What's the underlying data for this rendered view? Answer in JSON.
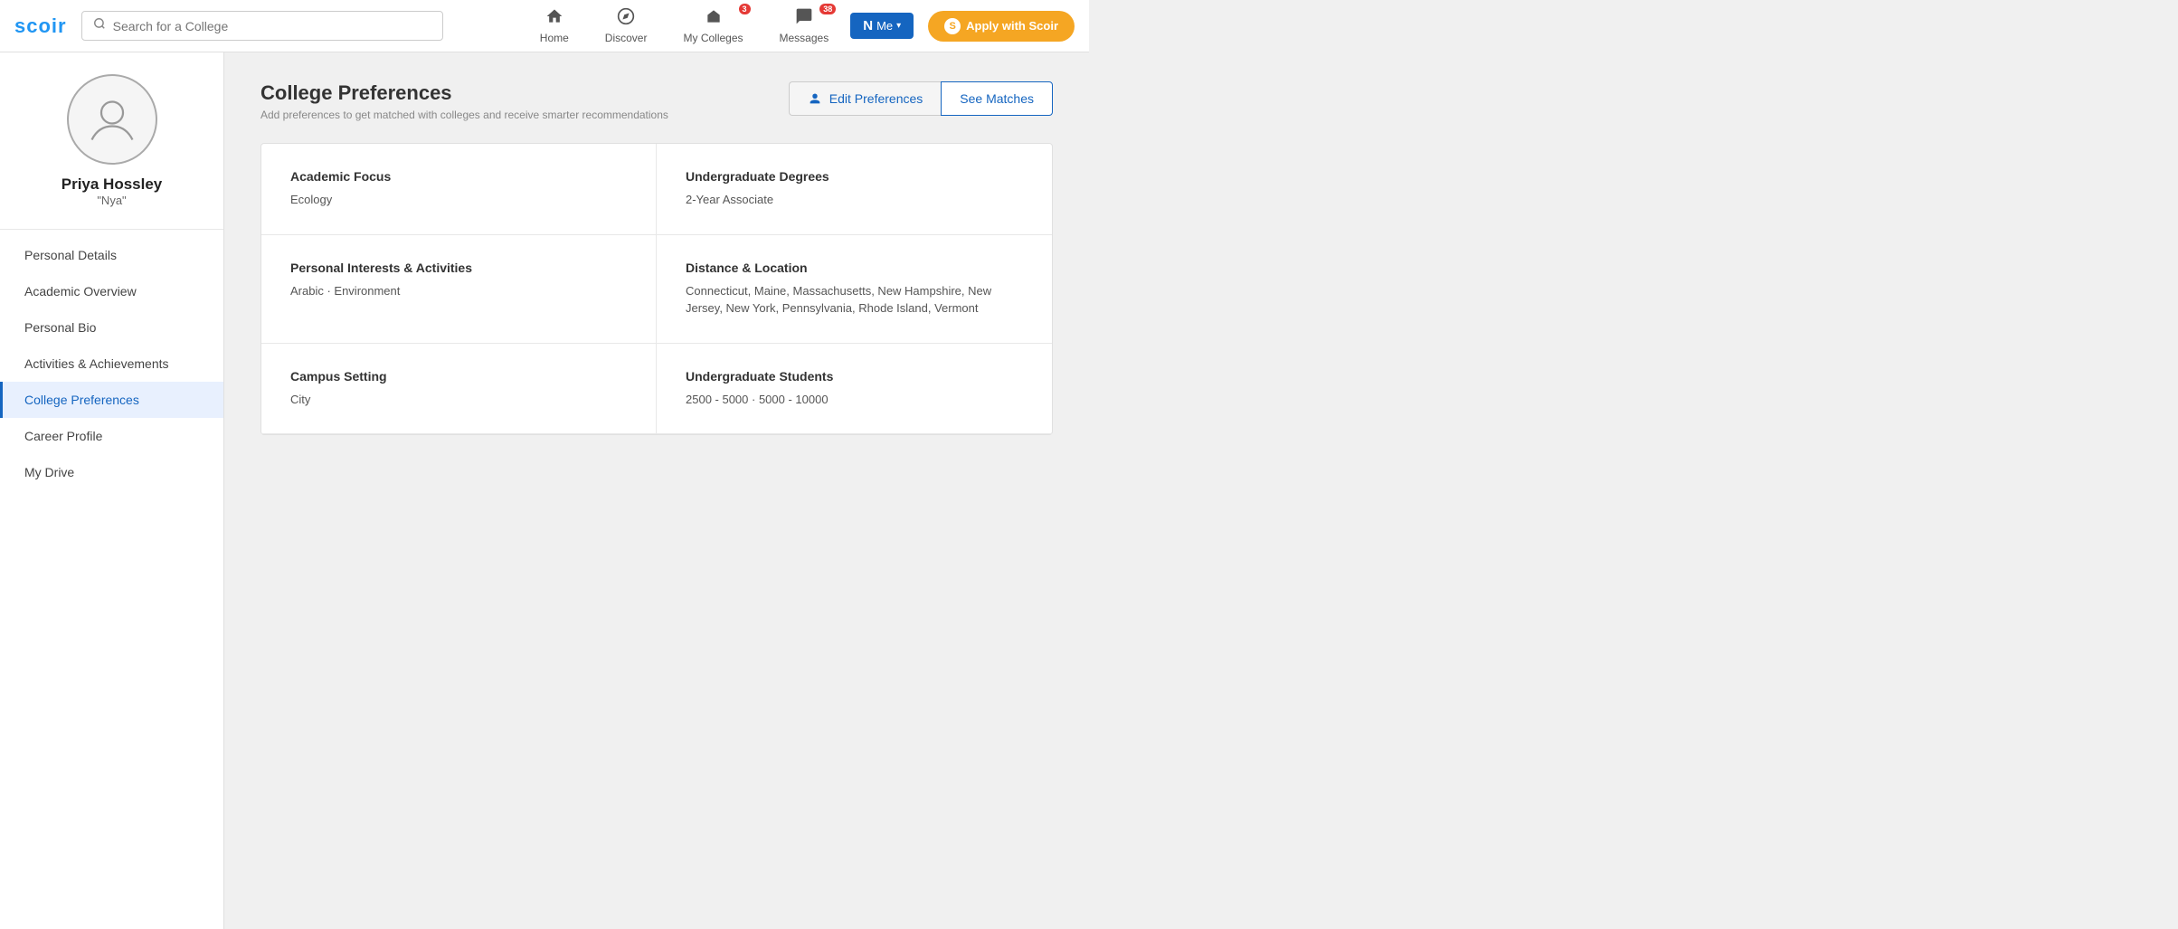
{
  "logo": {
    "text_black": "sc",
    "text_blue": "oir",
    "full": "scoir"
  },
  "search": {
    "placeholder": "Search for a College"
  },
  "nav": {
    "home": "Home",
    "discover": "Discover",
    "my_colleges": "My Colleges",
    "messages": "Messages",
    "me": "Me",
    "my_colleges_badge": "3",
    "messages_badge": "38",
    "apply": "Apply with Scoir"
  },
  "sidebar": {
    "user_name": "Priya Hossley",
    "user_nick": "\"Nya\"",
    "items": [
      {
        "label": "Personal Details",
        "id": "personal-details",
        "active": false
      },
      {
        "label": "Academic Overview",
        "id": "academic-overview",
        "active": false
      },
      {
        "label": "Personal Bio",
        "id": "personal-bio",
        "active": false
      },
      {
        "label": "Activities & Achievements",
        "id": "activities-achievements",
        "active": false
      },
      {
        "label": "College Preferences",
        "id": "college-preferences",
        "active": true
      },
      {
        "label": "Career Profile",
        "id": "career-profile",
        "active": false
      },
      {
        "label": "My Drive",
        "id": "my-drive",
        "active": false
      }
    ]
  },
  "main": {
    "page_title": "College Preferences",
    "page_subtitle": "Add preferences to get matched with colleges and receive smarter recommendations",
    "edit_preferences_label": "Edit Preferences",
    "see_matches_label": "See Matches",
    "preferences": [
      {
        "label": "Academic Focus",
        "value": "Ecology",
        "id": "academic-focus"
      },
      {
        "label": "Undergraduate Degrees",
        "value": "2-Year Associate",
        "id": "undergrad-degrees"
      },
      {
        "label": "Personal Interests & Activities",
        "value": "Arabic · Environment",
        "id": "personal-interests"
      },
      {
        "label": "Distance & Location",
        "value": "Connecticut, Maine, Massachusetts, New Hampshire, New Jersey, New York, Pennsylvania, Rhode Island, Vermont",
        "id": "distance-location"
      },
      {
        "label": "Campus Setting",
        "value": "City",
        "id": "campus-setting"
      },
      {
        "label": "Undergraduate Students",
        "value": "2500 - 5000 · 5000 - 10000",
        "id": "undergrad-students"
      }
    ]
  }
}
